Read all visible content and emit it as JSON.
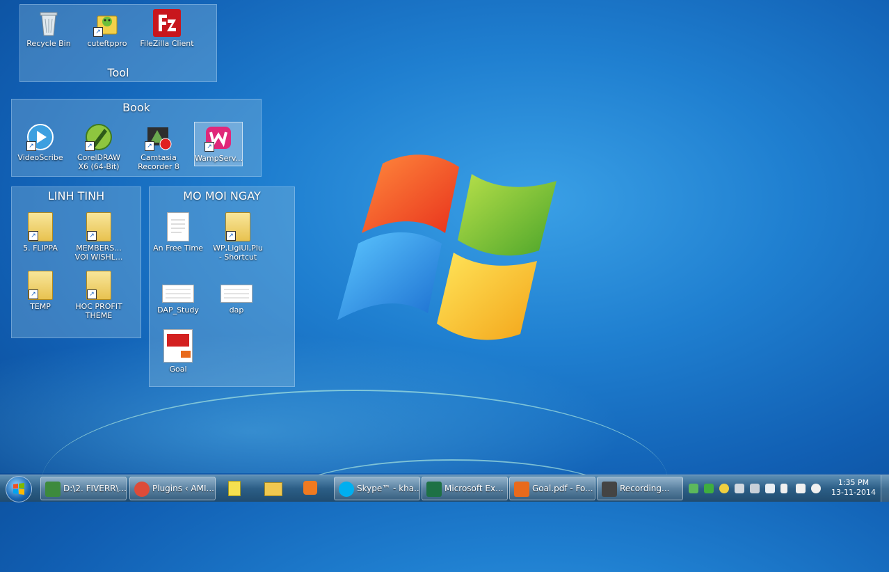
{
  "fences": [
    {
      "title": "Tool",
      "icons": [
        {
          "label": "Recycle Bin",
          "icon": "recycle-bin-icon"
        },
        {
          "label": "cuteftppro",
          "icon": "cuteftp-icon"
        },
        {
          "label": "FileZilla Client",
          "icon": "filezilla-icon"
        }
      ]
    },
    {
      "title": "Book",
      "icons": [
        {
          "label": "VideoScribe",
          "icon": "videoscribe-icon"
        },
        {
          "label": "CorelDRAW X6 (64-Bit)",
          "icon": "coreldraw-icon"
        },
        {
          "label": "Camtasia Recorder 8",
          "icon": "camtasia-icon"
        },
        {
          "label": "WampServ...",
          "icon": "wampserver-icon"
        }
      ]
    },
    {
      "title": "LINH TINH",
      "icons": [
        {
          "label": "5. FLIPPA",
          "icon": "folder-icon"
        },
        {
          "label": "MEMBERS... VOI WISHL...",
          "icon": "folder-icon"
        },
        {
          "label": "TEMP",
          "icon": "folder-icon"
        },
        {
          "label": "HOC PROFIT THEME",
          "icon": "folder-icon"
        }
      ]
    },
    {
      "title": "MO MOI NGAY",
      "icons": [
        {
          "label": "An Free Time",
          "icon": "text-document-icon"
        },
        {
          "label": "WP,LigiUI,Plu - Shortcut",
          "icon": "folder-icon"
        },
        {
          "label": "DAP_Study",
          "icon": "spreadsheet-icon"
        },
        {
          "label": "dap",
          "icon": "spreadsheet-icon"
        },
        {
          "label": "Goal",
          "icon": "pdf-icon"
        }
      ]
    }
  ],
  "taskbar": {
    "tasks": [
      {
        "label": "D:\\2. FIVERR\\...",
        "icon": "explorer-icon",
        "color": "#3d8a3d"
      },
      {
        "label": "Plugins ‹ AMI...",
        "icon": "chrome-icon",
        "color": "#dd4b39"
      },
      {
        "label": "Skype™ - kha...",
        "icon": "skype-icon",
        "color": "#00aff0"
      },
      {
        "label": "Microsoft Ex...",
        "icon": "excel-icon",
        "color": "#1e7145"
      },
      {
        "label": "Goal.pdf - Fo...",
        "icon": "foxit-pdf-icon",
        "color": "#e86a1c"
      },
      {
        "label": "Recording...",
        "icon": "camtasia-recording-icon",
        "color": "#444444"
      }
    ],
    "pinned": [
      {
        "icon": "sticky-notes-icon",
        "color": "#f5e050"
      },
      {
        "icon": "file-explorer-icon",
        "color": "#f0c850"
      },
      {
        "icon": "media-player-icon",
        "color": "#f07a20"
      }
    ],
    "clock_time": "1:35 PM",
    "clock_date": "13-11-2014"
  }
}
